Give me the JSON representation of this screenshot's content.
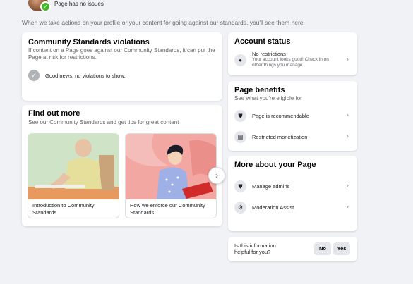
{
  "header": {
    "status_text": "Page has no issues",
    "intro_text": "When we take actions on your profile or your content for going against our standards, you'll see them here."
  },
  "community_standards": {
    "title": "Community Standards violations",
    "description": "If content on a Page goes against our Community Standards, it can put the Page at risk for restrictions.",
    "good_news": "Good news: no violations to show."
  },
  "find_out_more": {
    "title": "Find out more",
    "subtitle": "See our Community Standards and get tips for great content",
    "cards": [
      {
        "label": "Introduction to Community Standards"
      },
      {
        "label": "How we enforce our Community Standards"
      }
    ]
  },
  "account_status": {
    "title": "Account status",
    "item_title": "No restrictions",
    "item_sub": "Your account looks good! Check in on other things you manage."
  },
  "page_benefits": {
    "title": "Page benefits",
    "subtitle": "See what you're eligible for",
    "items": [
      {
        "label": "Page is recommendable"
      },
      {
        "label": "Restricted monetization"
      }
    ]
  },
  "more_about": {
    "title": "More about your Page",
    "items": [
      {
        "label": "Manage admins"
      },
      {
        "label": "Moderation Assist"
      }
    ]
  },
  "feedback": {
    "question": "Is this information helpful for you?",
    "no_label": "No",
    "yes_label": "Yes"
  },
  "colors": {
    "background": "#f0f2f5",
    "success_green": "#42b72a",
    "icon_gray": "#b0b3b8"
  }
}
